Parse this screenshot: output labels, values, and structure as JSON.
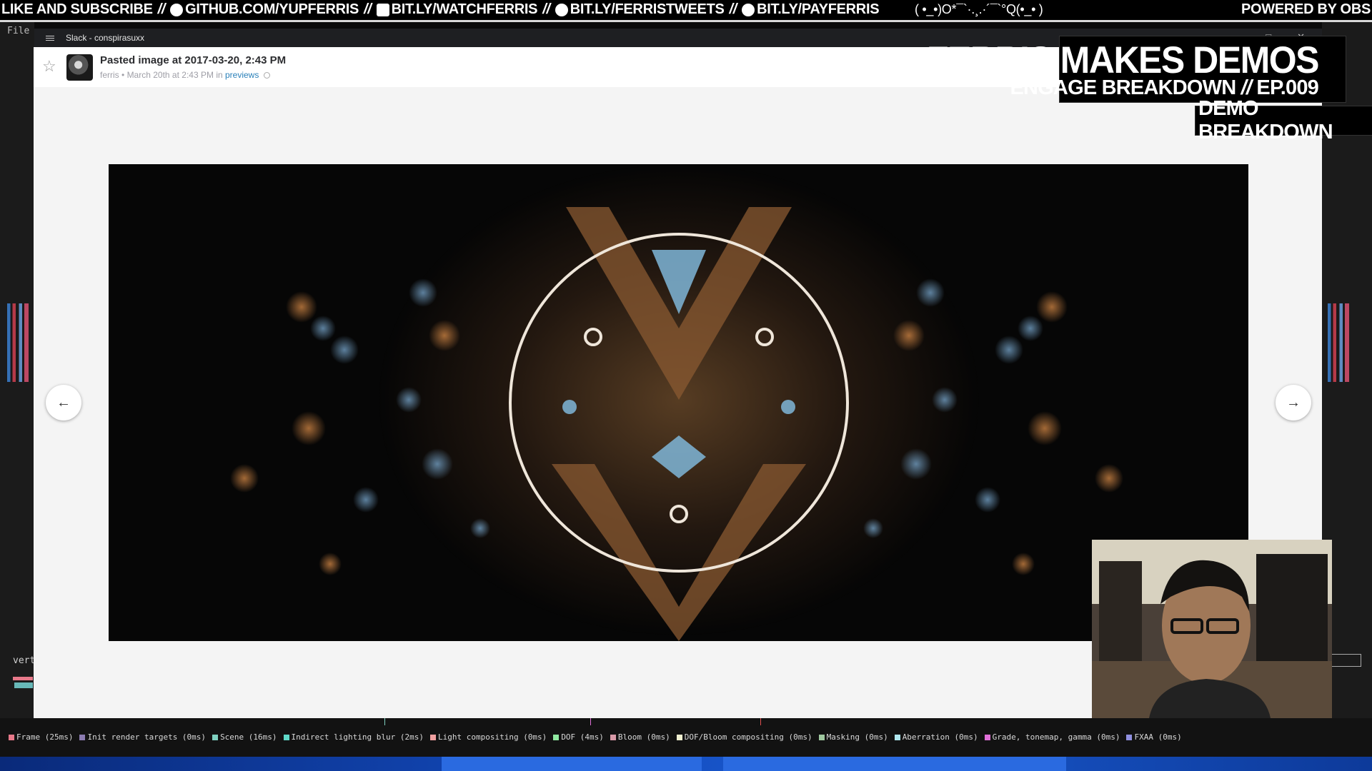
{
  "banner": {
    "lead": "LIKE AND SUBSCRIBE",
    "sep": "//",
    "links": [
      {
        "icon": "github-icon",
        "text": "GITHUB.COM/YUPFERRIS"
      },
      {
        "icon": "twitch-icon",
        "text": "BIT.LY/WATCHFERRIS"
      },
      {
        "icon": "twitter-icon",
        "text": "BIT.LY/FERRISTWEETS"
      },
      {
        "icon": "patreon-icon",
        "text": "BIT.LY/PAYFERRIS"
      }
    ],
    "emoticon": "( •_•)O*¯`·.¸.·´¯`°Q(•_• )",
    "powered": "POWERED BY OBS"
  },
  "editor": {
    "file_menu": "File",
    "vert_label": "vert"
  },
  "slack": {
    "window_title": "Slack - conspirasuxx",
    "window_controls": {
      "minimize": "—",
      "maximize": "□",
      "close": "✕"
    },
    "file": {
      "title": "Pasted image at 2017-03-20, 2:43 PM",
      "author": "ferris",
      "meta_sep": "•",
      "date_text": "March 20th at 2:43 PM",
      "in_text": "in",
      "channel": "previews"
    },
    "nav": {
      "prev": "←",
      "next": "→"
    }
  },
  "overlay": {
    "show_title": "FERRIS MAKES DEMOS",
    "episode_prefix": "ENGAGE BREAKDOWN",
    "episode_sep": "//",
    "episode": "EP.009",
    "segment": "DEMO BREAKDOWN"
  },
  "profiler": {
    "legend": [
      {
        "label": "Frame (25ms)",
        "color": "#e8798a"
      },
      {
        "label": "Init render targets (0ms)",
        "color": "#8b7bb0"
      },
      {
        "label": "Scene (16ms)",
        "color": "#7fd0c0"
      },
      {
        "label": "Indirect lighting blur (2ms)",
        "color": "#5fd8c8"
      },
      {
        "label": "Light compositing (0ms)",
        "color": "#f0a0a0"
      },
      {
        "label": "DOF (4ms)",
        "color": "#8fe8a0"
      },
      {
        "label": "Bloom (0ms)",
        "color": "#d89aa8"
      },
      {
        "label": "DOF/Bloom compositing (0ms)",
        "color": "#f0f0d0"
      },
      {
        "label": "Masking (0ms)",
        "color": "#a0c8a0"
      },
      {
        "label": "Aberration (0ms)",
        "color": "#b0e8f0"
      },
      {
        "label": "Grade, tonemap, gamma (0ms)",
        "color": "#e070d8"
      },
      {
        "label": "FXAA (0ms)",
        "color": "#9090e0"
      }
    ]
  },
  "colors": {
    "slack_link": "#2a80b9",
    "banner_bg": "#000000",
    "taskbar": "#1248b8"
  }
}
